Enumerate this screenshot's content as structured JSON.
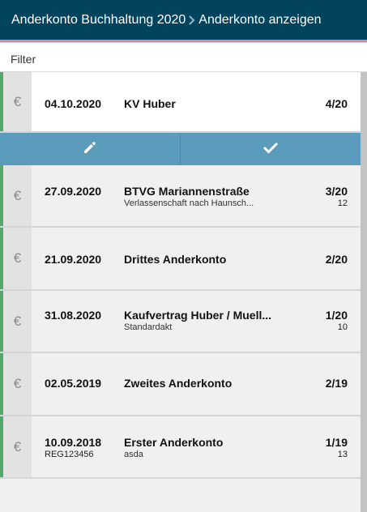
{
  "header": {
    "parent": "Anderkonto Buchhaltung 2020",
    "current": "Anderkonto anzeigen"
  },
  "filter": {
    "label": "Filter"
  },
  "currency_symbol": "€",
  "selected": {
    "date": "04.10.2020",
    "title": "KV Huber",
    "count": "4/20"
  },
  "rows": [
    {
      "date": "27.09.2020",
      "title": "BTVG Mariannenstraße",
      "desc": "Verlassenschaft nach Haunsch...",
      "count": "3/20",
      "sub_right": "12"
    },
    {
      "date": "21.09.2020",
      "title": "Drittes Anderkonto",
      "count": "2/20"
    },
    {
      "date": "31.08.2020",
      "title": "Kaufvertrag Huber / Muell...",
      "desc": "Standardakt",
      "count": "1/20",
      "sub_right": "10"
    },
    {
      "date": "02.05.2019",
      "title": "Zweites Anderkonto",
      "count": "2/19"
    },
    {
      "date": "10.09.2018",
      "sub_left": "REG123456",
      "title": "Erster Anderkonto",
      "desc": "asda",
      "count": "1/19",
      "sub_right": "13"
    }
  ],
  "colors": {
    "header_bg": "#02435e",
    "accent_stripe": "#55a86d",
    "action_bar": "#5b9bbb"
  },
  "icons": {
    "breadcrumb_separator": "chevron-right-icon",
    "edit": "pencil-icon",
    "confirm": "checkmark-icon",
    "row": "euro-icon"
  }
}
